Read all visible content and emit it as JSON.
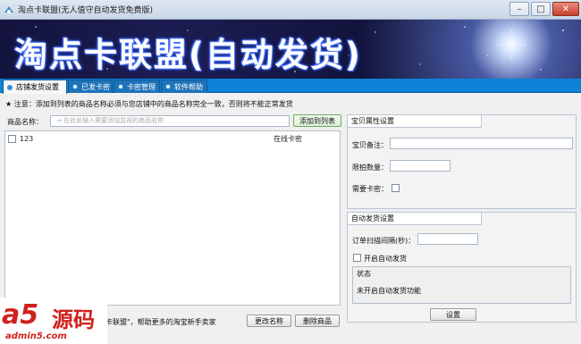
{
  "window": {
    "title": "淘点卡联盟(无人值守自动发货免费版)",
    "minimize_glyph": "–",
    "maximize_glyph": "□",
    "close_glyph": "✕"
  },
  "banner": {
    "title": "淘点卡联盟(自动发货)"
  },
  "tabs": [
    {
      "label": "店铺发货设置",
      "active": true
    },
    {
      "label": "已发卡密",
      "active": false
    },
    {
      "label": "卡密管理",
      "active": false
    },
    {
      "label": "软件帮助",
      "active": false
    }
  ],
  "notice": "★ 注意：添加到列表的商品名称必须与您店铺中的商品名称完全一致，否则将不能正常发货",
  "product": {
    "name_label": "商品名称：",
    "name_placeholder": "→  在此处输入需要添加监视的商品名称",
    "add_button": "添加到列表"
  },
  "product_list": [
    {
      "name": "123",
      "status": "在线卡密"
    }
  ],
  "bottom": {
    "help_text": "卡联盟\"，帮助更多的淘宝新手卖家",
    "rename_button": "更改名称",
    "delete_button": "删除商品"
  },
  "item_settings": {
    "title": "宝贝属性设置",
    "remark_label": "宝贝备注：",
    "limit_label": "限拍数量：",
    "need_card_label": "需要卡密："
  },
  "auto_ship": {
    "title": "自动发货设置",
    "interval_label": "订单扫描间隔(秒)：",
    "enable_label": "开启自动发货",
    "status_title": "状态",
    "status_text": "未开启自动发货功能",
    "settings_button": "设置"
  },
  "watermark": {
    "logo": "a5",
    "text": "源码",
    "url": "admin5.com"
  }
}
